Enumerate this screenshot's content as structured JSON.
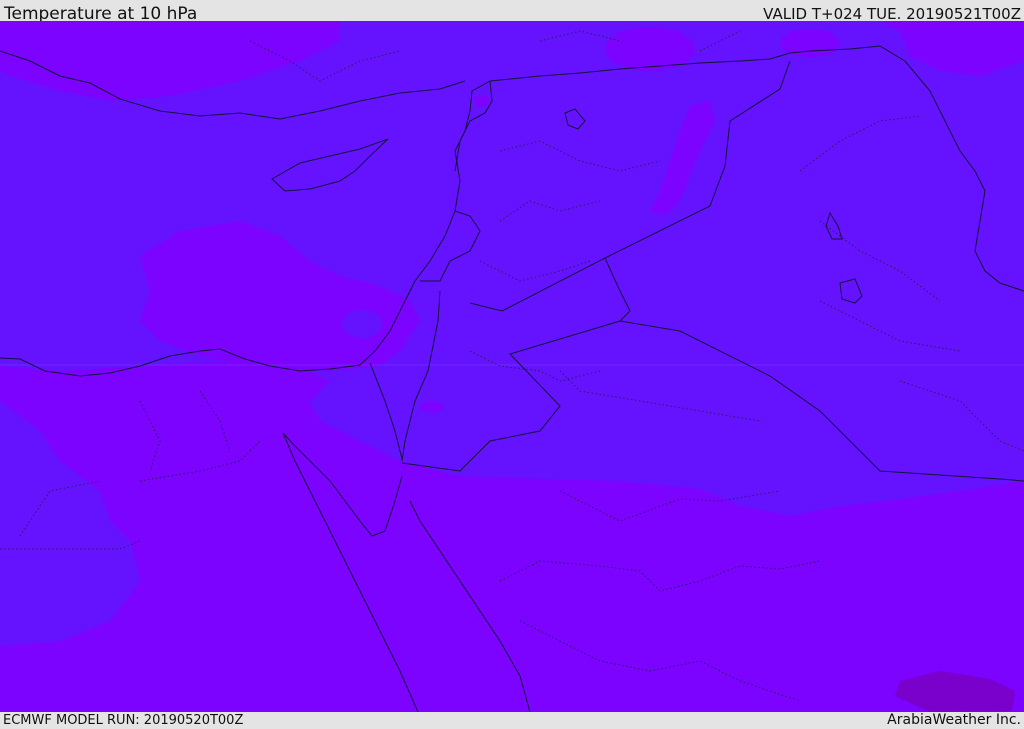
{
  "header": {
    "title": "Temperature at 10 hPa",
    "valid": "VALID T+024 TUE. 20190521T00Z"
  },
  "footer": {
    "model_run": "ECMWF MODEL RUN: 20190520T00Z",
    "credit": "ArabiaWeather Inc."
  },
  "colors": {
    "field_cool": "#6513ff",
    "field_warm": "#7b03ff",
    "field_warmest": "#7a00cc",
    "boundaries": "#14143a",
    "frame": "#e4e4e4"
  }
}
